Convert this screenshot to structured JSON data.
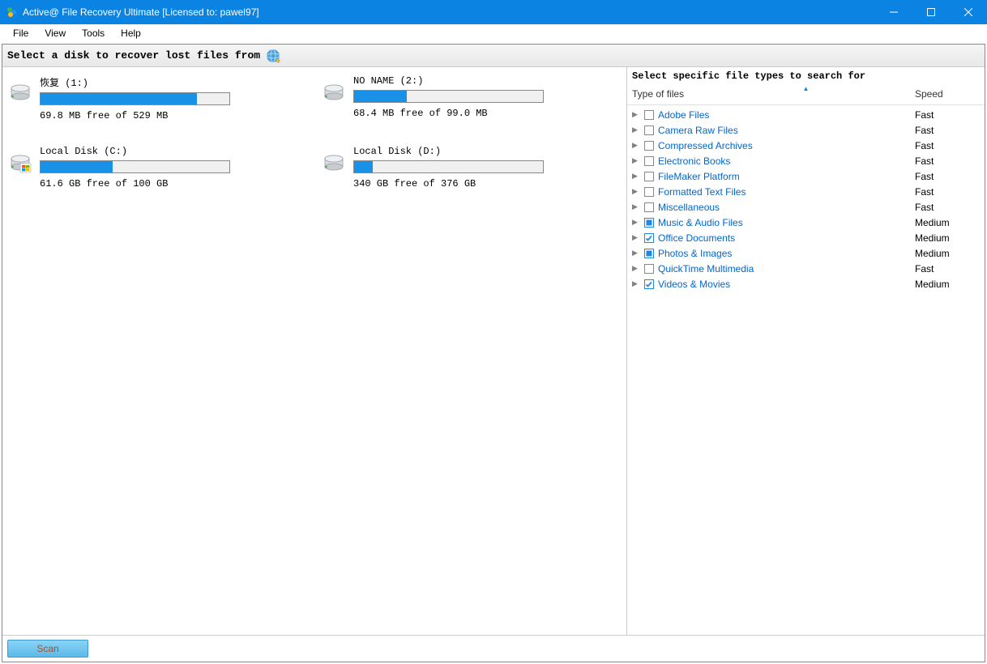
{
  "window": {
    "title": "Active@ File Recovery Ultimate [Licensed to: pawel97]"
  },
  "menu": {
    "file": "File",
    "view": "View",
    "tools": "Tools",
    "help": "Help"
  },
  "header": {
    "text": "Select a disk to recover lost files from"
  },
  "disks": [
    {
      "name": "恢复 (1:)",
      "free_text": "69.8 MB free of 529 MB",
      "fill_pct": 83,
      "variant": "plain"
    },
    {
      "name": "NO NAME (2:)",
      "free_text": "68.4 MB free of 99.0 MB",
      "fill_pct": 28,
      "variant": "plain"
    },
    {
      "name": "Local Disk (C:)",
      "free_text": "61.6 GB free of 100 GB",
      "fill_pct": 38,
      "variant": "windows"
    },
    {
      "name": "Local Disk (D:)",
      "free_text": "340 GB free of 376 GB",
      "fill_pct": 10,
      "variant": "plain"
    }
  ],
  "filetypes": {
    "heading": "Select specific file types to search for",
    "col_type": "Type of files",
    "col_speed": "Speed",
    "rows": [
      {
        "label": "Adobe Files",
        "speed": "Fast",
        "state": "empty"
      },
      {
        "label": "Camera Raw Files",
        "speed": "Fast",
        "state": "empty"
      },
      {
        "label": "Compressed Archives",
        "speed": "Fast",
        "state": "empty"
      },
      {
        "label": "Electronic Books",
        "speed": "Fast",
        "state": "empty"
      },
      {
        "label": "FileMaker Platform",
        "speed": "Fast",
        "state": "empty"
      },
      {
        "label": "Formatted Text Files",
        "speed": "Fast",
        "state": "empty"
      },
      {
        "label": "Miscellaneous",
        "speed": "Fast",
        "state": "empty"
      },
      {
        "label": "Music & Audio Files",
        "speed": "Medium",
        "state": "partial"
      },
      {
        "label": "Office Documents",
        "speed": "Medium",
        "state": "checked"
      },
      {
        "label": "Photos & Images",
        "speed": "Medium",
        "state": "partial"
      },
      {
        "label": "QuickTime Multimedia",
        "speed": "Fast",
        "state": "empty"
      },
      {
        "label": "Videos & Movies",
        "speed": "Medium",
        "state": "checked"
      }
    ]
  },
  "footer": {
    "scan": "Scan"
  }
}
